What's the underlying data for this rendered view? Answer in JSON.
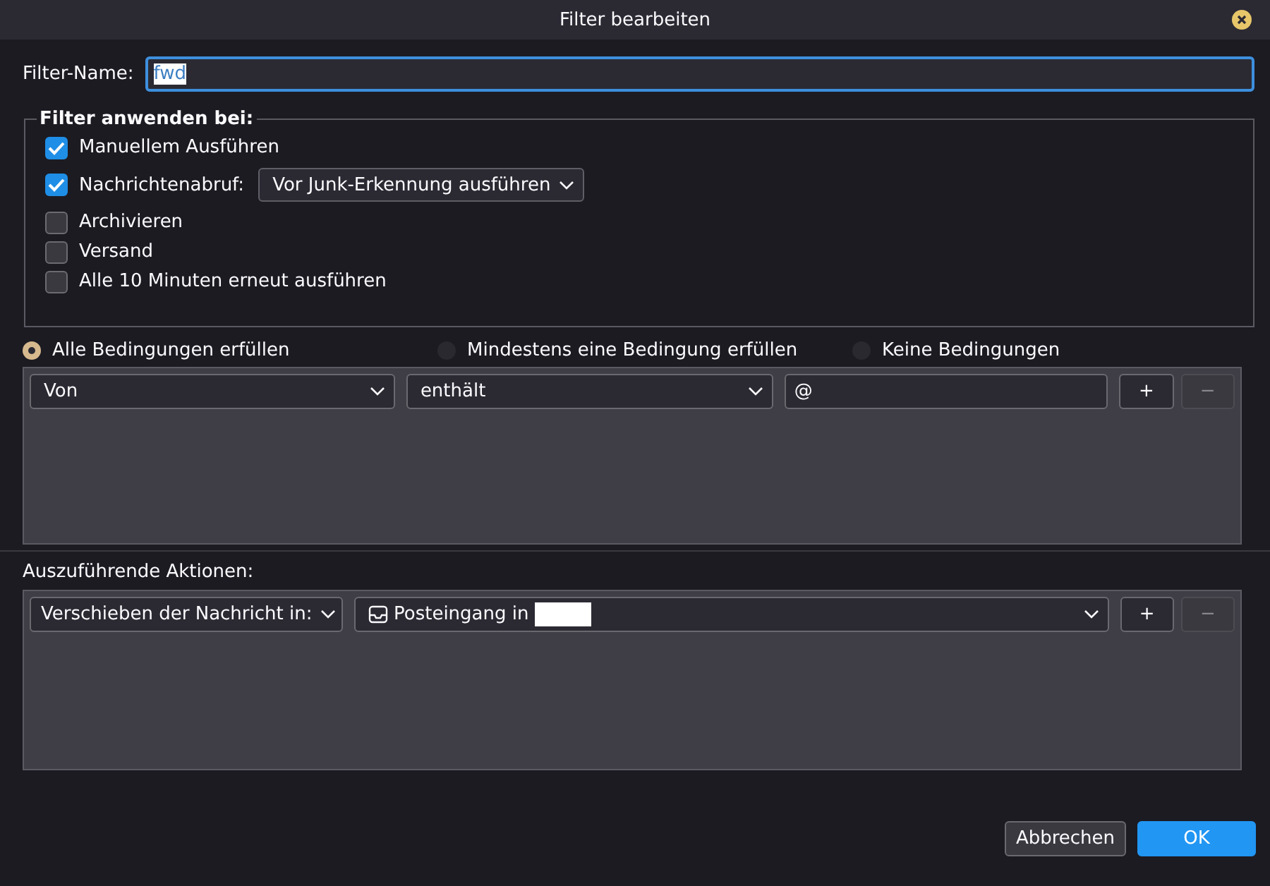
{
  "window": {
    "title": "Filter bearbeiten"
  },
  "filter_name": {
    "label": "Filter-Name:",
    "value": "fwd",
    "text_selected": true
  },
  "apply_on": {
    "legend": "Filter anwenden bei:",
    "options": [
      {
        "label": "Manuellem Ausführen",
        "checked": true
      },
      {
        "label": "Nachrichtenabruf:",
        "checked": true,
        "dropdown": "Vor Junk-Erkennung ausführen"
      },
      {
        "label": "Archivieren",
        "checked": false
      },
      {
        "label": "Versand",
        "checked": false
      },
      {
        "label": "Alle 10 Minuten erneut ausführen",
        "checked": false
      }
    ]
  },
  "match": [
    {
      "label": "Alle Bedingungen erfüllen",
      "selected": true
    },
    {
      "label": "Mindestens eine Bedingung erfüllen",
      "selected": false
    },
    {
      "label": "Keine Bedingungen",
      "selected": false
    }
  ],
  "conditions": [
    {
      "field": "Von",
      "operator": "enthält",
      "value": "@",
      "add": {
        "label": "+",
        "disabled": false
      },
      "remove": {
        "label": "−",
        "disabled": true
      }
    }
  ],
  "actions_label": "Auszuführende Aktionen:",
  "actions": [
    {
      "action": "Verschieben der Nachricht in:",
      "target": "Posteingang in",
      "add": {
        "label": "+",
        "disabled": false
      },
      "remove": {
        "label": "−",
        "disabled": true
      }
    }
  ],
  "buttons": [
    {
      "label": "Abbrechen",
      "kind": "secondary"
    },
    {
      "label": "OK",
      "kind": "primary"
    }
  ]
}
